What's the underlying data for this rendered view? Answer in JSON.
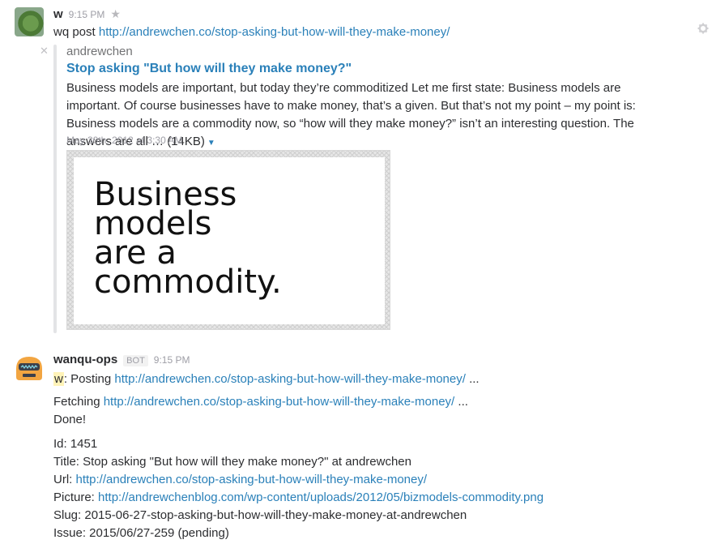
{
  "message1": {
    "author": "w",
    "time": "9:15 PM",
    "text_prefix": "wq post ",
    "link": "http://andrewchen.co/stop-asking-but-how-will-they-make-money/",
    "attachment": {
      "service": "andrewchen",
      "title": "Stop asking \"But how will they make money?\"",
      "text": "Business models are important, but today they’re commoditized Let me first state: Business models are important. Of course businesses have to make money, that’s a given. But that’s not my point – my point is: Business models are a commodity now, so “how will they make money?” isn’t an interesting question. The answers are all … ",
      "size": "(14KB)",
      "date": "May 30th, 2012 at 3:30 AM",
      "image_text": [
        "Business",
        "models",
        "are a",
        "commodity."
      ]
    }
  },
  "message2": {
    "author": "wanqu-ops",
    "badge": "BOT",
    "time": "9:15 PM",
    "lines": {
      "posting_mention": "w",
      "posting_prefix": ": Posting ",
      "posting_link": "http://andrewchen.co/stop-asking-but-how-will-they-make-money/",
      "posting_suffix": " ...",
      "fetching_prefix": "Fetching ",
      "fetching_link": "http://andrewchen.co/stop-asking-but-how-will-they-make-money/",
      "fetching_suffix": " ...",
      "done": "Done!",
      "id": "Id: 1451",
      "title": "Title: Stop asking \"But how will they make money?\" at andrewchen",
      "url_prefix": "Url: ",
      "url_link": "http://andrewchen.co/stop-asking-but-how-will-they-make-money/",
      "picture_prefix": "Picture: ",
      "picture_link": "http://andrewchenblog.com/wp-content/uploads/2012/05/bizmodels-commodity.png",
      "slug": "Slug: 2015-06-27-stop-asking-but-how-will-they-make-money-at-andrewchen",
      "issue": "Issue: 2015/06/27-259 (pending)"
    }
  },
  "icons": {
    "star": "star-icon",
    "gear": "gear-icon",
    "close": "close-icon",
    "caret": "caret-down-icon"
  }
}
